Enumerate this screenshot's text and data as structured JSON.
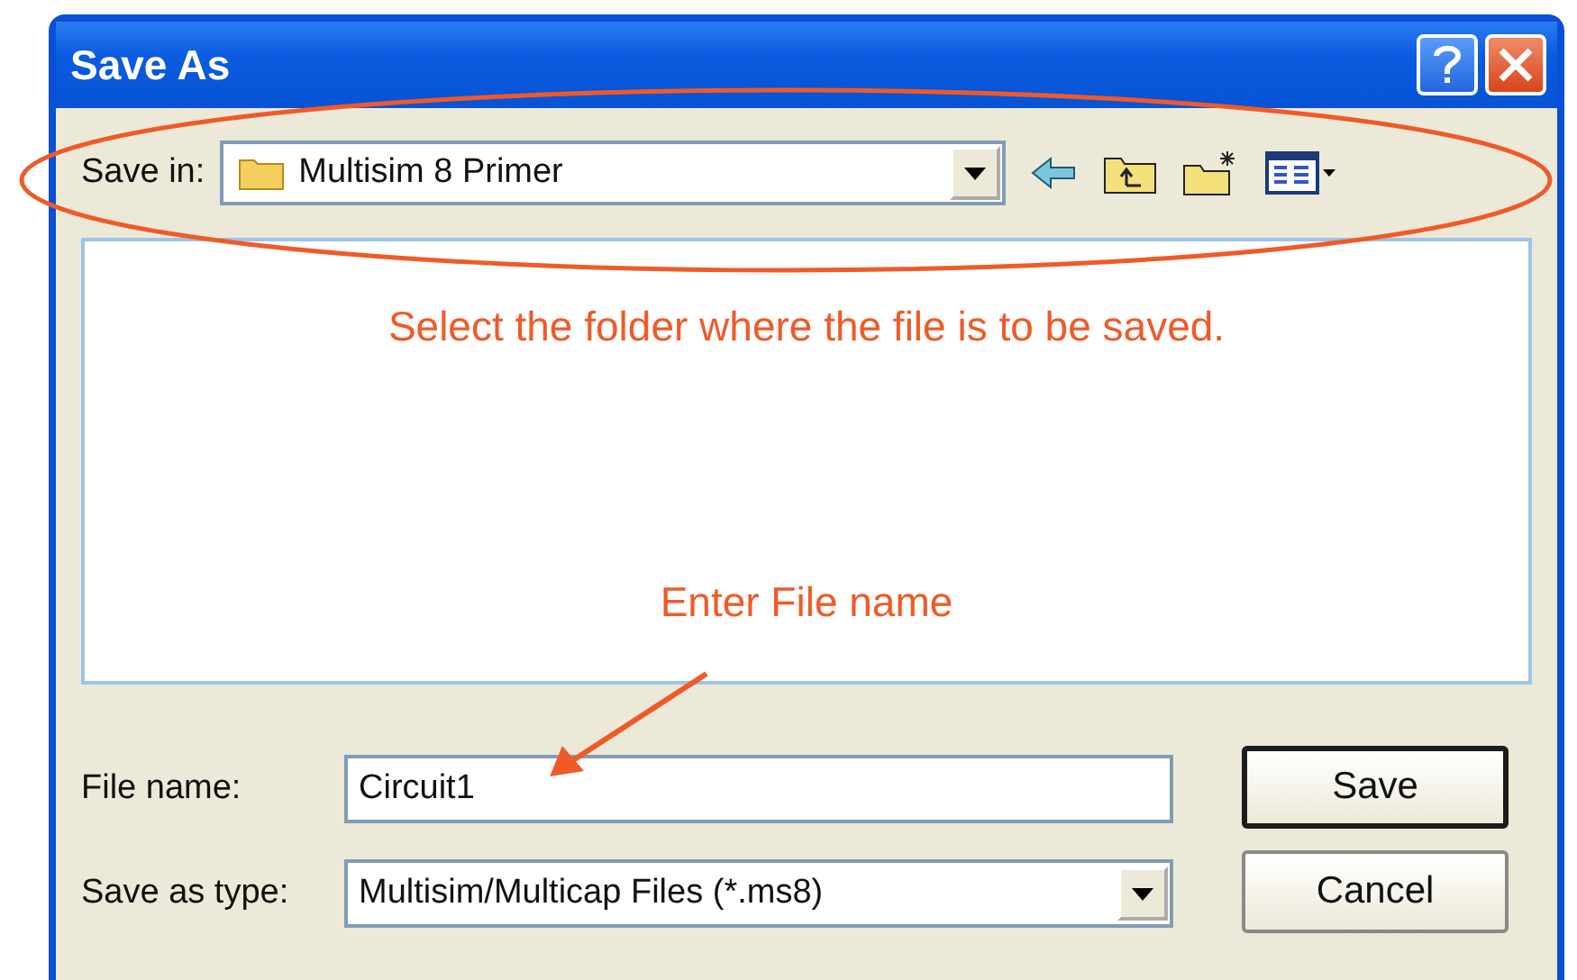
{
  "window": {
    "title": "Save As"
  },
  "save_in": {
    "label": "Save in:",
    "value": "Multisim 8 Primer"
  },
  "annotations": [
    {
      "text": "Select the folder where the file is to be saved."
    },
    {
      "text": "Enter File name"
    }
  ],
  "fields": [
    {
      "kind": "text",
      "label": "File name:",
      "value": "Circuit1"
    },
    {
      "kind": "dropdown",
      "label": "Save as type:",
      "value": "Multisim/Multicap Files (*.ms8)"
    }
  ],
  "buttons": [
    {
      "label": "Save",
      "default": true
    },
    {
      "label": "Cancel",
      "default": false
    }
  ]
}
